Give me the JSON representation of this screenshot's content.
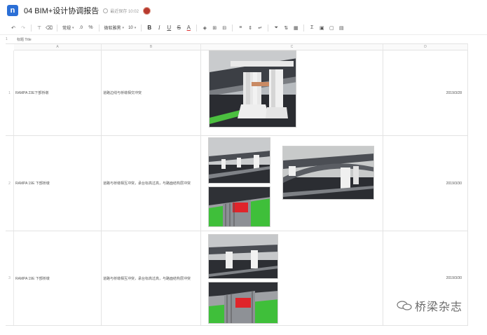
{
  "app": {
    "logo_letter": "n",
    "doc_title": "04 BIM+设计协调报告",
    "saved_status": "最近保存 10:02"
  },
  "toolbar": {
    "undo_icon": "undo-icon",
    "redo_icon": "redo-icon",
    "format_painter_icon": "paint-format-icon",
    "clear_format_icon": "clear-format-icon",
    "number_format_label": "常规",
    "decimal_label": ".0",
    "font_name_label": "微软雅黑",
    "font_size_label": "10",
    "bold_label": "B",
    "italic_label": "I",
    "underline_label": "U",
    "strike_label": "S",
    "font_color_label": "A"
  },
  "formula_bar": {
    "cell_ref": "1",
    "value": "标题 Title"
  },
  "columns": [
    "A",
    "B",
    "C",
    "D"
  ],
  "rows": [
    {
      "num": "1",
      "name": "RAMPA 23E下部桥墩",
      "issue": "道路边线与桥墩相交冲突",
      "date": "2019/3/28"
    },
    {
      "num": "2",
      "name": "RAMPA 19E 下部桥墩",
      "issue": "道路与桥墩相互冲突，承台标高过高，与路面结构层冲突",
      "date": "2019/3/30"
    },
    {
      "num": "3",
      "name": "RAMPA 19E 下部桥墩",
      "issue": "道路与桥墩相互冲突，承台标高过高，与路面结构层冲突",
      "date": "2019/3/30"
    }
  ],
  "watermark": {
    "text": "桥梁杂志"
  },
  "colors": {
    "brand": "#2b6fd6",
    "clash_red": "#e0242a",
    "road_green": "#3fbf3a",
    "sky_grey": "#c7c9cb"
  }
}
